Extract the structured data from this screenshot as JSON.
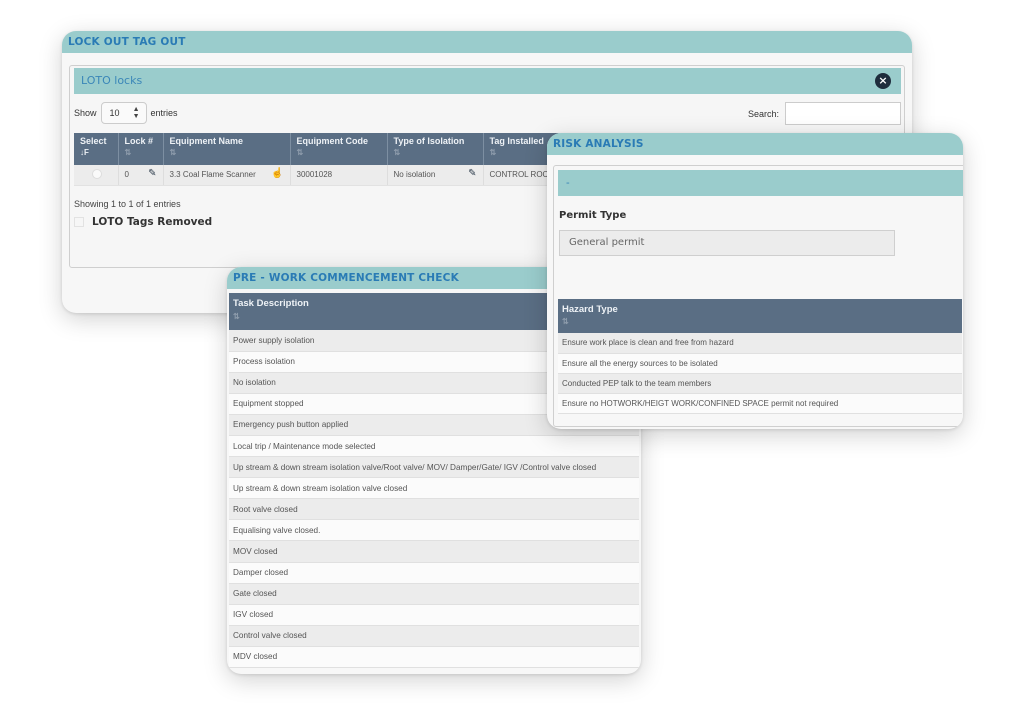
{
  "loto": {
    "title": "LOCK OUT TAG OUT",
    "subheader": "LOTO locks",
    "close_icon": "×",
    "show_label": "Show",
    "entries_value": "10",
    "entries_label": "entries",
    "search_label": "Search:",
    "search_value": "",
    "columns": [
      {
        "label": "Select",
        "sort": "↓F"
      },
      {
        "label": "Lock #",
        "sort": "⇅"
      },
      {
        "label": "Equipment Name",
        "sort": "⇅"
      },
      {
        "label": "Equipment Code",
        "sort": "⇅"
      },
      {
        "label": "Type of Isolation",
        "sort": "⇅"
      },
      {
        "label": "Tag Installed",
        "sort": "⇅"
      }
    ],
    "rows": [
      {
        "lock": "0",
        "equipment_name": "3.3 Coal Flame Scanner",
        "equipment_code": "30001028",
        "isolation": "No isolation",
        "tag_installed": "CONTROL ROC"
      }
    ],
    "info": "Showing 1 to 1 of 1 entries",
    "tags_removed_label": "LOTO Tags Removed",
    "icons": {
      "edit": "✎",
      "pointer": "☝"
    }
  },
  "prework": {
    "title": "PRE - WORK COMMENCEMENT CHECK",
    "column": "Task Description",
    "sort": "⇅",
    "tasks": [
      "Power supply isolation",
      "Process isolation",
      "No isolation",
      "Equipment stopped",
      "Emergency push button applied",
      "Local trip / Maintenance mode selected",
      "Up stream & down stream isolation valve/Root valve/ MOV/ Damper/Gate/ IGV /Control valve closed",
      "Up stream & down stream isolation valve closed",
      "Root valve closed",
      "Equalising valve closed.",
      "MOV closed",
      "Damper closed",
      "Gate closed",
      "IGV closed",
      "Control valve closed",
      "MDV closed"
    ]
  },
  "risk": {
    "title": "RISK ANALYSIS",
    "subheader": "-",
    "permit_label": "Permit Type",
    "permit_value": "General permit",
    "column": "Hazard Type",
    "sort": "⇅",
    "hazards": [
      "Ensure work place is clean and free from hazard",
      "Ensure all the energy sources to be isolated",
      "Conducted PEP talk to the team members",
      "Ensure no HOTWORK/HEIGT WORK/CONFINED SPACE permit not required"
    ]
  }
}
